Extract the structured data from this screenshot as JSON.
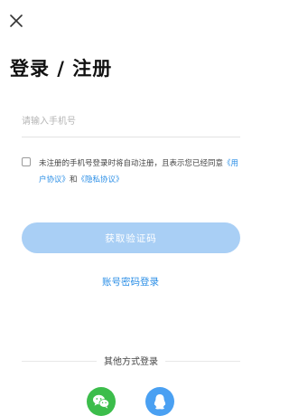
{
  "header": {
    "close_icon": "close-icon"
  },
  "title": "登录 / 注册",
  "phone": {
    "placeholder": "请输入手机号",
    "value": ""
  },
  "agreement": {
    "checked": false,
    "text_before": "未注册的手机号登录时将自动注册，且表示您已经同意",
    "user_agreement": "《用户协议》",
    "conjunction": "和",
    "privacy_agreement": "《隐私协议》"
  },
  "buttons": {
    "get_code": "获取验证码",
    "password_login": "账号密码登录"
  },
  "other_login": {
    "label": "其他方式登录",
    "providers": [
      {
        "icon": "wechat-icon",
        "color": "#3cbd4b"
      },
      {
        "icon": "qq-icon",
        "color": "#4aa0f2"
      }
    ]
  },
  "colors": {
    "accent": "#2a8ee6",
    "button_disabled": "#a9cff5"
  }
}
